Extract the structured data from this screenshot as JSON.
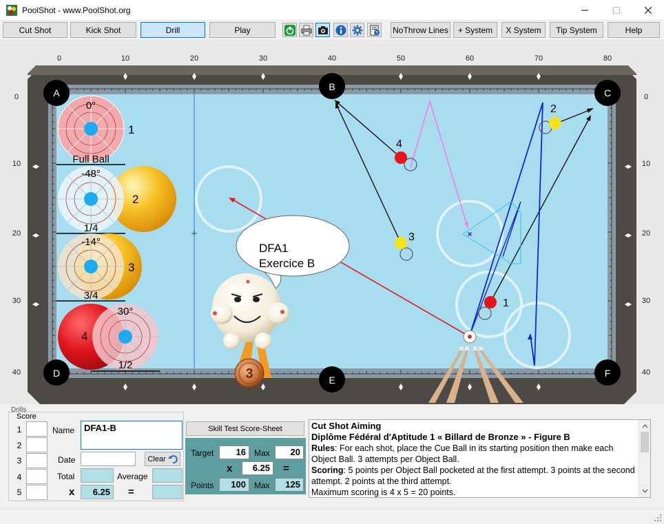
{
  "window": {
    "title": "PoolShot - www.PoolShot.org"
  },
  "toolbar": {
    "buttons": [
      {
        "label": "Cut Shot"
      },
      {
        "label": "Kick Shot"
      },
      {
        "label": "Drill"
      },
      {
        "label": "Play"
      },
      {
        "label": "NoThrow Lines"
      },
      {
        "label": "+ System"
      },
      {
        "label": "X System"
      },
      {
        "label": "Tip System"
      },
      {
        "label": "Help"
      }
    ],
    "active_mode": "Drill",
    "icons": [
      "power-icon",
      "print-icon",
      "camera-icon",
      "info-icon",
      "settings-icon",
      "help-document-icon"
    ]
  },
  "table": {
    "pockets": [
      "A",
      "B",
      "C",
      "D",
      "E",
      "F"
    ],
    "x_ruler": [
      "0",
      "10",
      "20",
      "30",
      "40",
      "50",
      "60",
      "70",
      "80"
    ],
    "y_ruler": [
      "0",
      "10",
      "20",
      "30",
      "40"
    ],
    "balls": [
      {
        "number": "1",
        "color": "#e8141c"
      },
      {
        "number": "2",
        "color": "#f5e21b"
      },
      {
        "number": "3",
        "color": "#f5e21b"
      },
      {
        "number": "4",
        "color": "#e8141c"
      }
    ],
    "aim_guides": [
      {
        "angle": "0°",
        "number": "1",
        "label": "Full Ball"
      },
      {
        "angle": "-48°",
        "number": "2",
        "label": "1/4"
      },
      {
        "angle": "-14°",
        "number": "3",
        "label": "3/4"
      },
      {
        "angle": "30°",
        "number": "4",
        "label": "1/2"
      }
    ],
    "speech_bubble": [
      "DFA1",
      "Exercice B"
    ],
    "medal": "3",
    "colors": {
      "cloth": "#a8ddf0",
      "rail": "#4d4945",
      "red_path": "#e31b23",
      "blue_path": "#1525d6",
      "black_path": "#111111",
      "pink_path": "#f07ef0"
    }
  },
  "drills": {
    "legend": "Drills",
    "score": {
      "legend": "Score",
      "rows": [
        "1",
        "2",
        "3",
        "4",
        "5"
      ],
      "name_label": "Name",
      "name_value": "DFA1-B",
      "date_label": "Date",
      "date_value": "",
      "clear_label": "Clear",
      "total_label": "Total",
      "average_label": "Average",
      "multiplier_sign": "x",
      "multiplier_value": "6.25",
      "equals_sign": "="
    },
    "skill_test": {
      "button_label": "Skill Test Score-Sheet",
      "target_label": "Target",
      "target_value": "16",
      "max_label": "Max",
      "max_value": "20",
      "mult_sign": "x",
      "mult_value": "6.25",
      "eq_sign": "=",
      "points_label": "Points",
      "points_value": "100",
      "points_max_label": "Max",
      "points_max_value": "125"
    },
    "description": {
      "title": "Cut Shot Aiming",
      "subtitle": "Diplôme Fédéral d'Aptitude 1 « Billard de Bronze » - Figure B",
      "rules_label": "Rules",
      "rules_text": ": For each shot, place the Cue Ball in its starting position then make each Object Ball. 3 attempts per Object Ball.",
      "scoring_label": "Scoring",
      "scoring_text": ": 5 points per Object Ball pocketed at the first attempt. 3 points at the second attempt. 2 points at the third attempt.",
      "max_text": "Maximum scoring is 4 x 5 = 20 points."
    }
  }
}
